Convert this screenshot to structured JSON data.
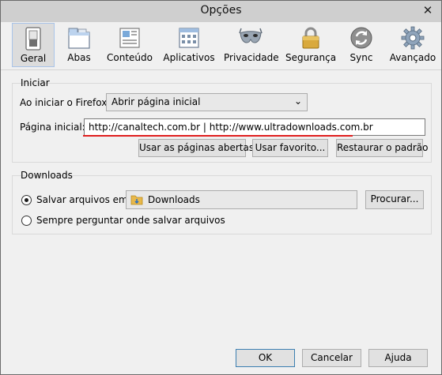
{
  "window": {
    "title": "Opções",
    "close_glyph": "✕"
  },
  "toolbar": {
    "tabs": [
      {
        "label": "Geral",
        "icon": "switch-icon",
        "active": true
      },
      {
        "label": "Abas",
        "icon": "tabs-window-icon",
        "active": false
      },
      {
        "label": "Conteúdo",
        "icon": "content-page-icon",
        "active": false
      },
      {
        "label": "Aplicativos",
        "icon": "applications-window-icon",
        "active": false
      },
      {
        "label": "Privacidade",
        "icon": "mask-icon",
        "active": false
      },
      {
        "label": "Segurança",
        "icon": "padlock-icon",
        "active": false
      },
      {
        "label": "Sync",
        "icon": "sync-icon",
        "active": false
      },
      {
        "label": "Avançado",
        "icon": "gear-icon",
        "active": false
      }
    ]
  },
  "startup": {
    "group_title": "Iniciar",
    "on_start_label": "Ao iniciar o Firefox:",
    "on_start_value": "Abrir página inicial",
    "homepage_label": "Página inicial:",
    "homepage_value": "http://canaltech.com.br | http://www.ultradownloads.com.br",
    "use_open_pages": "Usar as páginas abertas",
    "use_bookmark": "Usar favorito...",
    "restore_default": "Restaurar o padrão"
  },
  "downloads": {
    "group_title": "Downloads",
    "save_files_label": "Salvar arquivos em:",
    "folder_name": "Downloads",
    "browse": "Procurar...",
    "always_ask_label": "Sempre perguntar onde salvar arquivos"
  },
  "footer": {
    "ok": "OK",
    "cancel": "Cancelar",
    "help": "Ajuda"
  },
  "colors": {
    "highlight_underline": "#e01e1e",
    "active_tab_border": "#a9c4e8"
  }
}
